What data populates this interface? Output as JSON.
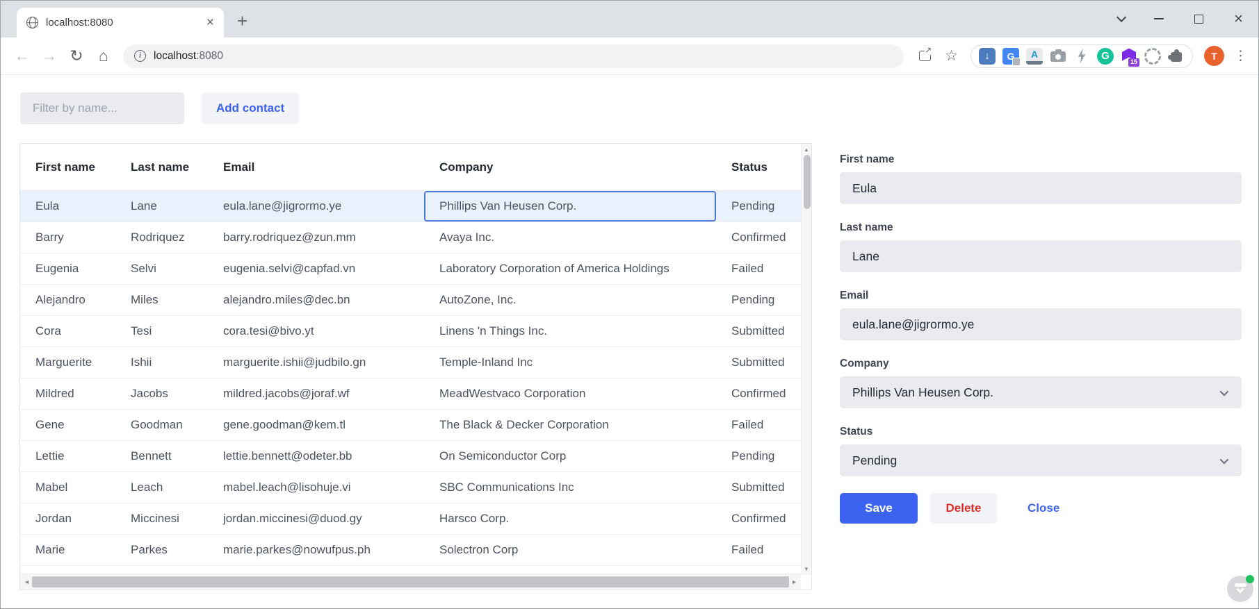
{
  "browser": {
    "tab_title": "localhost:8080",
    "url_host": "localhost",
    "url_port": ":8080",
    "profile_initial": "T",
    "extension_badge": "15",
    "extensions": [
      "download",
      "translate",
      "keyboard-a",
      "camera",
      "lightning",
      "grammarly",
      "purple-badge",
      "gear",
      "puzzle"
    ]
  },
  "icons": {
    "back": "←",
    "forward": "→",
    "reload": "↻",
    "home": "⌂",
    "share_arrow": "↗",
    "star": "☆",
    "kebab": "⋮",
    "info_i": "i",
    "tab_close": "×",
    "new_tab": "+",
    "win_close": "×",
    "download_arrow": "↓",
    "translate_letter": "G",
    "keyboard_letter": "A",
    "grammarly_letter": "G",
    "scroll_up": "▲",
    "scroll_down": "▼",
    "scroll_left": "◄",
    "scroll_right": "►"
  },
  "app": {
    "filter": {
      "placeholder": "Filter by name..."
    },
    "add_contact_label": "Add contact",
    "grid": {
      "columns": [
        "First name",
        "Last name",
        "Email",
        "Company",
        "Status"
      ],
      "selected_row": 0,
      "focused_column": "company",
      "rows": [
        {
          "first": "Eula",
          "last": "Lane",
          "email": "eula.lane@jigrormo.ye",
          "company": "Phillips Van Heusen Corp.",
          "status": "Pending"
        },
        {
          "first": "Barry",
          "last": "Rodriquez",
          "email": "barry.rodriquez@zun.mm",
          "company": "Avaya Inc.",
          "status": "Confirmed"
        },
        {
          "first": "Eugenia",
          "last": "Selvi",
          "email": "eugenia.selvi@capfad.vn",
          "company": "Laboratory Corporation of America Holdings",
          "status": "Failed"
        },
        {
          "first": "Alejandro",
          "last": "Miles",
          "email": "alejandro.miles@dec.bn",
          "company": "AutoZone, Inc.",
          "status": "Pending"
        },
        {
          "first": "Cora",
          "last": "Tesi",
          "email": "cora.tesi@bivo.yt",
          "company": "Linens 'n Things Inc.",
          "status": "Submitted"
        },
        {
          "first": "Marguerite",
          "last": "Ishii",
          "email": "marguerite.ishii@judbilo.gn",
          "company": "Temple-Inland Inc",
          "status": "Submitted"
        },
        {
          "first": "Mildred",
          "last": "Jacobs",
          "email": "mildred.jacobs@joraf.wf",
          "company": "MeadWestvaco Corporation",
          "status": "Confirmed"
        },
        {
          "first": "Gene",
          "last": "Goodman",
          "email": "gene.goodman@kem.tl",
          "company": "The Black & Decker Corporation",
          "status": "Failed"
        },
        {
          "first": "Lettie",
          "last": "Bennett",
          "email": "lettie.bennett@odeter.bb",
          "company": "On Semiconductor Corp",
          "status": "Pending"
        },
        {
          "first": "Mabel",
          "last": "Leach",
          "email": "mabel.leach@lisohuje.vi",
          "company": "SBC Communications Inc",
          "status": "Submitted"
        },
        {
          "first": "Jordan",
          "last": "Miccinesi",
          "email": "jordan.miccinesi@duod.gy",
          "company": "Harsco Corp.",
          "status": "Confirmed"
        },
        {
          "first": "Marie",
          "last": "Parkes",
          "email": "marie.parkes@nowufpus.ph",
          "company": "Solectron Corp",
          "status": "Failed"
        }
      ]
    },
    "form": {
      "fields": [
        {
          "label": "First name",
          "value": "Eula",
          "type": "text"
        },
        {
          "label": "Last name",
          "value": "Lane",
          "type": "text"
        },
        {
          "label": "Email",
          "value": "eula.lane@jigrormo.ye",
          "type": "text"
        },
        {
          "label": "Company",
          "value": "Phillips Van Heusen Corp.",
          "type": "select"
        },
        {
          "label": "Status",
          "value": "Pending",
          "type": "select"
        }
      ],
      "buttons": {
        "save": "Save",
        "delete": "Delete",
        "close": "Close"
      }
    }
  },
  "colors": {
    "primary_blue": "#3c63f0",
    "danger_red": "#d93025",
    "selected_row_bg": "#e9f1fd",
    "focus_ring": "#4d79da",
    "field_bg": "#e9ebef",
    "button_bg": "#f3f4f7",
    "chrome_frame": "#dee1e6",
    "avatar_orange": "#e8622c",
    "grammarly_green": "#15c39a",
    "badge_purple": "#8c3fd9",
    "gizmo_dot_green": "#21c25e"
  }
}
